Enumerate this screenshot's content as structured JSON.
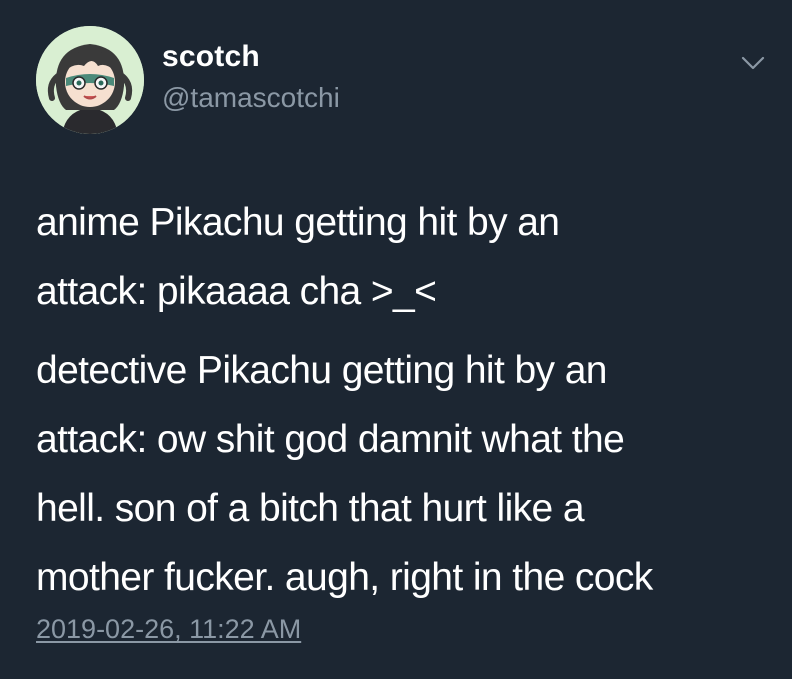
{
  "user": {
    "display_name": "scotch",
    "handle": "@tamascotchi",
    "avatar_icon": "anime-character-avatar-icon"
  },
  "menu": {
    "icon": "chevron-down-icon"
  },
  "tweet": {
    "paragraph_1_line_1": "anime Pikachu getting hit by an",
    "paragraph_1_line_2": "attack: pikaaaa cha >_<",
    "paragraph_2_line_1": "detective Pikachu getting hit by an",
    "paragraph_2_line_2": "attack: ow shit god damnit what the",
    "paragraph_2_line_3": "hell. son of a bitch that hurt like a",
    "paragraph_2_line_4": "mother fucker. augh, right in the cock",
    "timestamp": "2019-02-26, 11:22 AM"
  },
  "colors": {
    "background": "#1c2632",
    "text_primary": "#ffffff",
    "text_secondary": "#8b98a5"
  }
}
